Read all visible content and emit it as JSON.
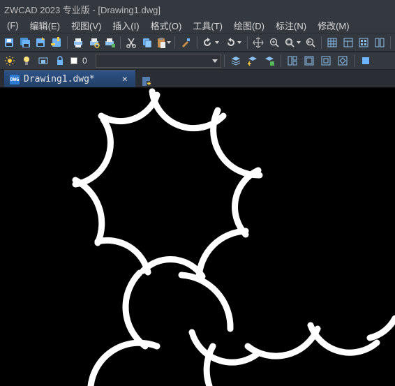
{
  "titlebar": "ZWCAD 2023 专业版 - [Drawing1.dwg]",
  "menu": {
    "file": "(F)",
    "edit": "编辑(E)",
    "view": "视图(V)",
    "insert": "插入(I)",
    "format": "格式(O)",
    "tools": "工具(T)",
    "draw": "绘图(D)",
    "dimension": "标注(N)",
    "modify": "修改(M)"
  },
  "layer": {
    "current": "0"
  },
  "tab": {
    "label": "Drawing1.dwg*",
    "icon_text": "DWG"
  }
}
